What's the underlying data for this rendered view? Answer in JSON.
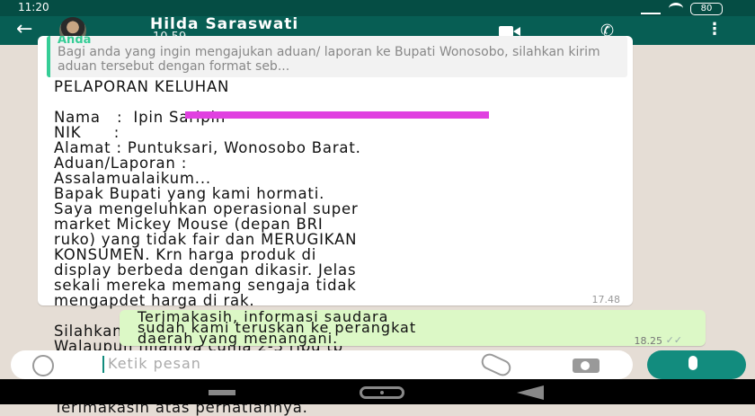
{
  "status_bar": {
    "time": "11:20",
    "battery": "80"
  },
  "header": {
    "back_icon": "arrow-left-icon",
    "title": "Hilda Saraswati",
    "subtitle": "10.59"
  },
  "quoted": {
    "author": "Anda",
    "text": "Bagi anda yang ingin mengajukan aduan/ laporan ke Bupati Wonosobo, silahkan kirim aduan tersebut dengan format seb..."
  },
  "incoming_message": {
    "text": "PELAPORAN KELUHAN\n\nNama   :  Ipin Saripin\nNIK      :\nAlamat : Puntuksari, Wonosobo Barat.\nAduan/Laporan :\nAssalamualaikum...\nBapak Bupati yang kami hormati.\nSaya mengeluhkan operasional super\nmarket Mickey Mouse (depan BRI\nruko) yang tidak fair dan MERUGIKAN\nKONSUMEN. Krn harga produk di\ndisplay berbeda dengan dikasir. Jelas\nsekali mereka memang sengaja tidak\nmengapdet harga di rak.\n\nSilahkan diinvestigasi diam-diam.\nWalaupun nilainya cuma 2-3 ribu tp\njika dikalikan jumlah pembeli sdh\nbisa jadi living cost ownernya.\n\nTerimakasih atas perhatiannya.",
    "time": "17.48"
  },
  "outgoing_message": {
    "text": "Terimakasih, informasi saudara\nsudah kami teruskan ke perangkat\ndaerah yang menangani.",
    "time": "18.25"
  },
  "composer": {
    "placeholder": "Ketik pesan"
  }
}
